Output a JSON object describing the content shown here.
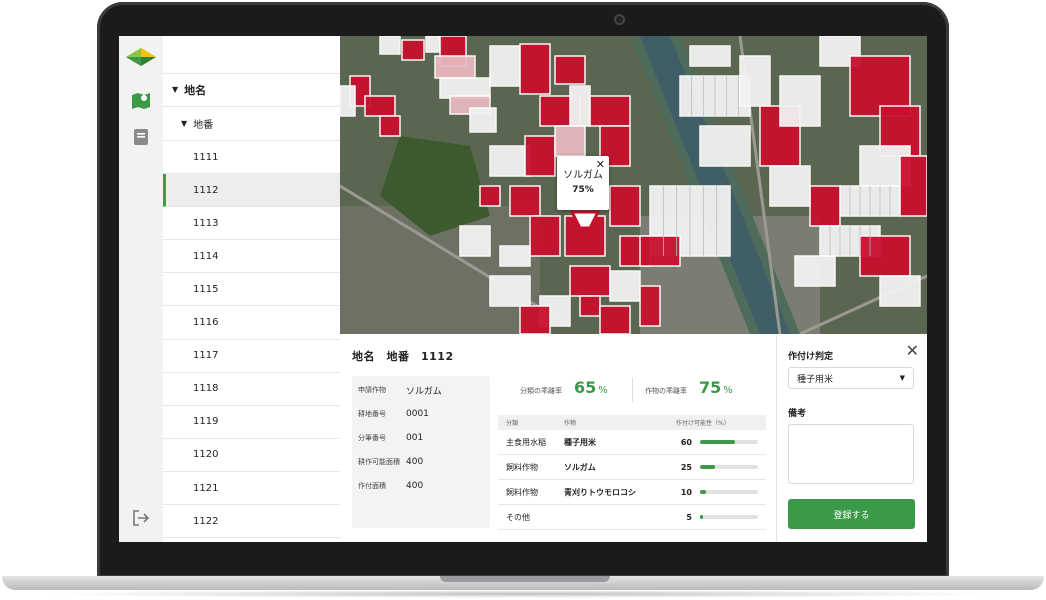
{
  "tree": {
    "root_label": "地名",
    "child_label": "地番",
    "items": [
      "1111",
      "1112",
      "1113",
      "1114",
      "1115",
      "1116",
      "1117",
      "1118",
      "1119",
      "1120",
      "1121",
      "1122"
    ],
    "selected_index": 1
  },
  "map_popup": {
    "crop": "ソルガム",
    "percent": "75%",
    "close": "✕"
  },
  "detail": {
    "title": "地名　地番　1112",
    "info": [
      {
        "label": "申請作物",
        "value": "ソルガム"
      },
      {
        "label": "耕地番号",
        "value": "0001"
      },
      {
        "label": "分筆番号",
        "value": "001"
      },
      {
        "label": "耕作可能面積",
        "value": "400"
      },
      {
        "label": "作付面積",
        "value": "400"
      }
    ],
    "rate_category": {
      "label": "分類の乖離率",
      "value": "65",
      "unit": "%"
    },
    "rate_crop": {
      "label": "作物の乖離率",
      "value": "75",
      "unit": "%"
    },
    "table": {
      "headers": [
        "分類",
        "作物",
        "作付け可能性（%）"
      ],
      "rows": [
        {
          "category": "主食用水稲",
          "crop": "種子用米",
          "value": "60",
          "fraction": 0.6
        },
        {
          "category": "飼料作物",
          "crop": "ソルガム",
          "value": "25",
          "fraction": 0.25
        },
        {
          "category": "飼料作物",
          "crop": "青刈りトウモロコシ",
          "value": "10",
          "fraction": 0.1
        },
        {
          "category": "その他",
          "crop": "",
          "value": "5",
          "fraction": 0.05
        }
      ]
    }
  },
  "side": {
    "title": "作付け判定",
    "close": "✕",
    "select_value": "種子用米",
    "note_label": "備考",
    "submit_label": "登録する"
  },
  "colors": {
    "accent": "#3a9a48",
    "field_red": "#c8102e",
    "field_white": "#f2f2f2"
  }
}
